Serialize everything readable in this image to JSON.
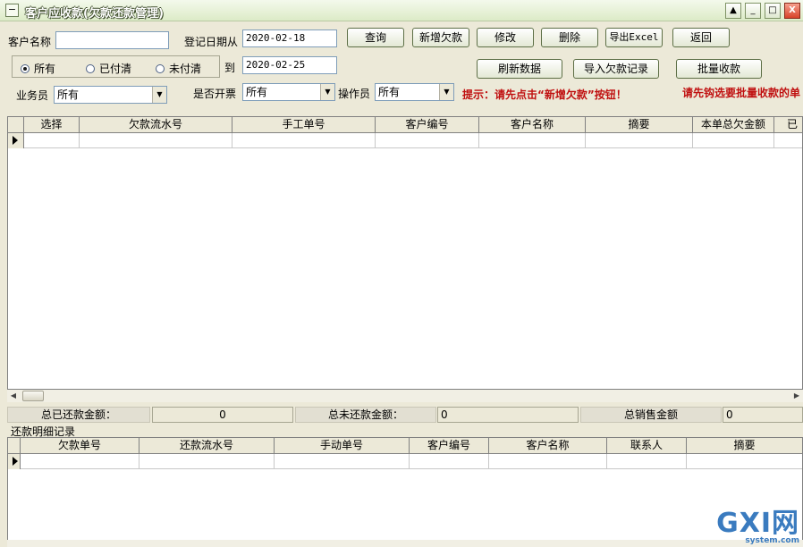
{
  "window": {
    "title": "客户应收款(欠款还款管理)",
    "controls": {
      "minimize": "_",
      "maximize": "□",
      "close": "X",
      "menu": "▲"
    }
  },
  "filters": {
    "customer_name_label": "客户名称",
    "customer_name_value": "",
    "date_from_label": "登记日期从",
    "date_from_value": "2020-02-18",
    "date_to_label": "到",
    "date_to_value": "2020-02-25",
    "status_options": [
      "所有",
      "已付清",
      "未付清"
    ],
    "status_selected": "所有",
    "salesperson_label": "业务员",
    "salesperson_value": "所有",
    "invoice_label": "是否开票",
    "invoice_value": "所有",
    "operator_label": "操作员",
    "operator_value": "所有"
  },
  "toolbar": {
    "query": "查询",
    "new_debt": "新增欠款",
    "edit": "修改",
    "delete": "删除",
    "export_excel": "导出Excel",
    "back": "返回",
    "refresh": "刷新数据",
    "import_debt": "导入欠款记录",
    "batch_collect": "批量收款"
  },
  "hints": {
    "tip": "提示：请先点击“新增欠款”按钮！",
    "batch_tip": "请先钩选要批量收款的单"
  },
  "debt_table": {
    "columns": [
      "选择",
      "欠款流水号",
      "手工单号",
      "客户编号",
      "客户名称",
      "摘要",
      "本单总欠金额",
      "已"
    ]
  },
  "totals": {
    "paid_label": "总已还款金额：",
    "paid_value": "0",
    "unpaid_label": "总未还款金额：",
    "unpaid_value": "0",
    "sales_label": "总销售金额",
    "sales_value": "0"
  },
  "detail_section": {
    "title": "还款明细记录",
    "columns": [
      "欠款单号",
      "还款流水号",
      "手动单号",
      "客户编号",
      "客户名称",
      "联系人",
      "摘要"
    ]
  },
  "watermark": {
    "main": "GXI网",
    "sub": "system.com"
  }
}
